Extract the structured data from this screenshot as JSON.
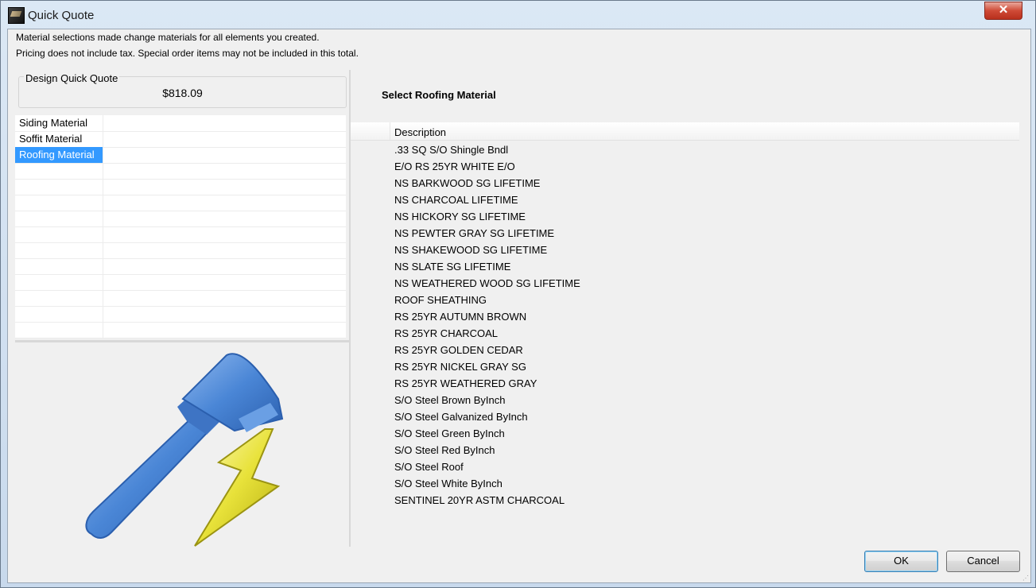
{
  "window": {
    "title": "Quick Quote",
    "close_label": "✕"
  },
  "info": {
    "line1": "Material selections made change materials for all elements you created.",
    "line2": "Pricing does not include tax. Special order items may not be included in this total."
  },
  "quote": {
    "group_title": "Design Quick Quote",
    "price": "$818.09"
  },
  "materials_grid": {
    "rows": [
      "Siding Material",
      "Soffit Material",
      "Roofing Material",
      "",
      "",
      "",
      "",
      "",
      "",
      "",
      "",
      "",
      "",
      ""
    ],
    "selected_index": 2
  },
  "right_panel": {
    "title": "Select Roofing Material",
    "column_header": "Description",
    "items": [
      ".33 SQ S/O Shingle Bndl",
      "E/O RS 25YR WHITE E/O",
      "NS BARKWOOD SG LIFETIME",
      "NS CHARCOAL LIFETIME",
      "NS HICKORY SG LIFETIME",
      "NS PEWTER GRAY SG LIFETIME",
      "NS SHAKEWOOD SG LIFETIME",
      "NS SLATE SG LIFETIME",
      "NS WEATHERED WOOD SG LIFETIME",
      "ROOF SHEATHING",
      "RS 25YR AUTUMN BROWN",
      "RS 25YR CHARCOAL",
      "RS 25YR GOLDEN CEDAR",
      "RS 25YR NICKEL GRAY SG",
      "RS 25YR WEATHERED GRAY",
      "S/O Steel Brown ByInch",
      "S/O Steel Galvanized ByInch",
      "S/O Steel Green ByInch",
      "S/O Steel Red ByInch",
      "S/O Steel Roof",
      "S/O Steel White ByInch",
      "SENTINEL 20YR ASTM CHARCOAL"
    ]
  },
  "buttons": {
    "ok": "OK",
    "cancel": "Cancel"
  },
  "icons": {
    "app": "house-thumbnail-icon",
    "illustration": "paintbrush-lightning-icon"
  },
  "colors": {
    "selection": "#3399ff",
    "brush_blue": "#4a86d6",
    "bolt_yellow": "#e8e23a"
  }
}
